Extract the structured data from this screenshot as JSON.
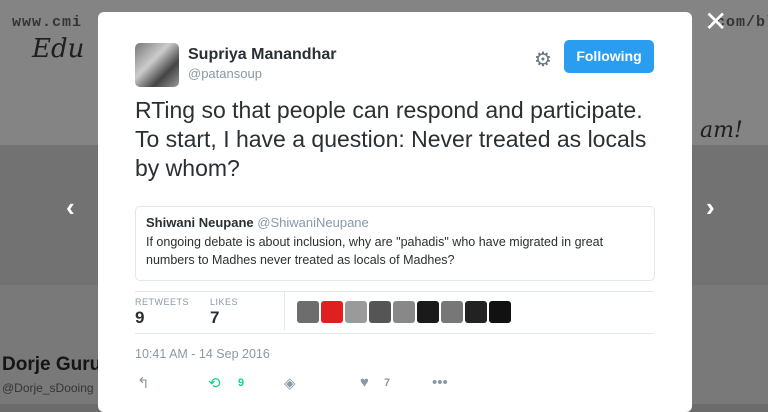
{
  "background": {
    "url_left": "www.cmi",
    "url_right": ".com/bl",
    "scribble_left": "Edu",
    "scribble_right": "am!",
    "profile_name": "Dorje Guru",
    "profile_handle": "@Dorje_sDooing"
  },
  "nav": {
    "prev_glyph": "‹",
    "next_glyph": "›",
    "close_glyph": "✕"
  },
  "tweet": {
    "author_name": "Supriya Manandhar",
    "author_handle": "@patansoup",
    "follow_label": "Following",
    "text": "RTing so that people can respond and participate. To start, I have a question: Never treated as locals by whom?",
    "quote": {
      "author_name": "Shiwani Neupane",
      "author_handle": "@ShiwaniNeupane",
      "text": "If ongoing debate is about inclusion, why are \"pahadis\" who have migrated in great numbers to Madhes never treated as locals of Madhes?"
    },
    "stats": {
      "retweets_label": "RETWEETS",
      "retweets": "9",
      "likes_label": "LIKES",
      "likes": "7"
    },
    "likers": [
      "#6d6d6d",
      "#e02020",
      "#9a9a9a",
      "#555555",
      "#888888",
      "#1a1a1a",
      "#777777",
      "#222222",
      "#111111"
    ],
    "timestamp": "10:41 AM - 14 Sep 2016",
    "actions": {
      "retweet_count": "9",
      "like_count": "7"
    }
  },
  "colors": {
    "follow_button": "#2b9df0",
    "secondary_text": "#8899a6",
    "primary_text": "#292f33"
  }
}
